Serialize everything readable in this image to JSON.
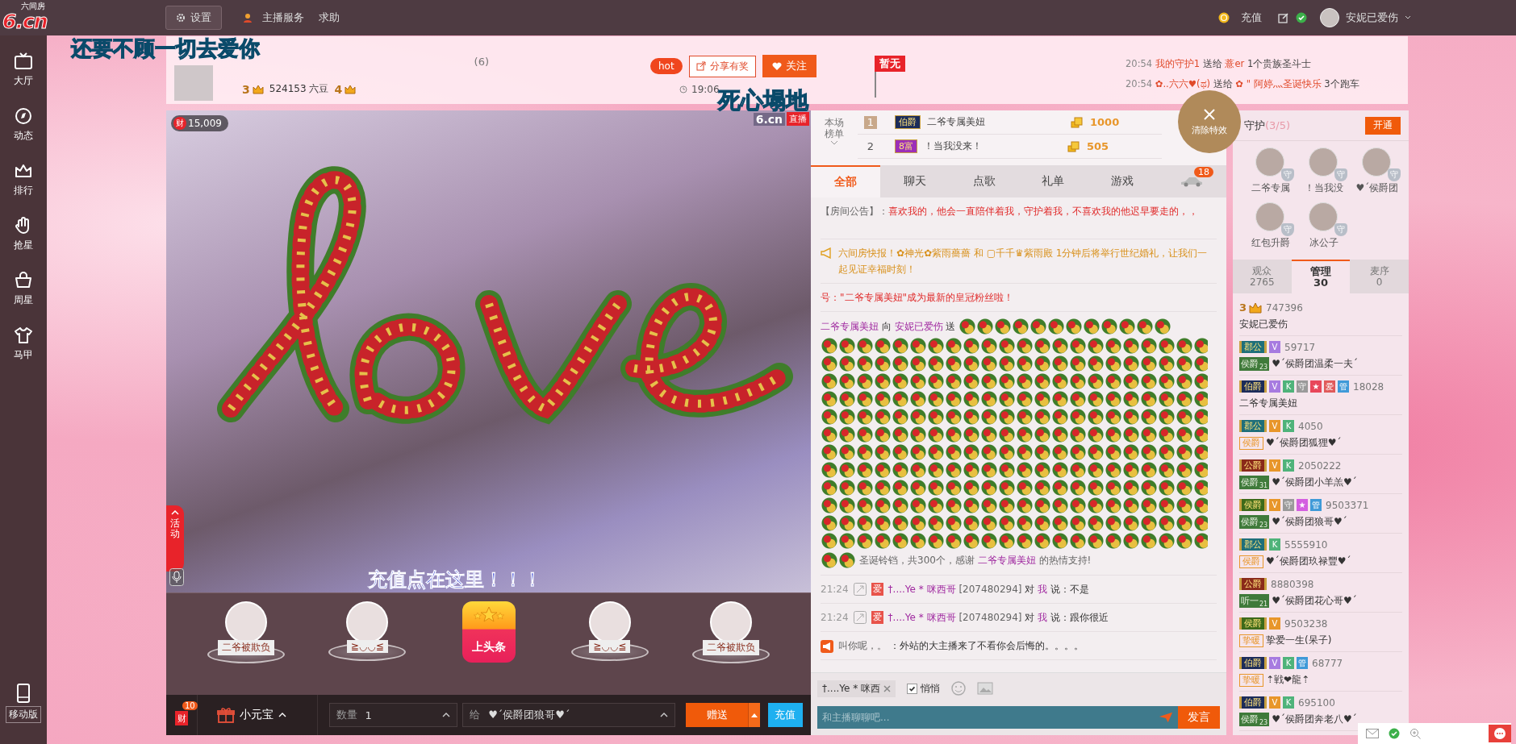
{
  "top_bar": {
    "logo": "6.cn",
    "logo_sub": "六间房",
    "settings": "设置",
    "links": [
      "主播服务",
      "求助"
    ],
    "recharge": "充值",
    "user": "安妮已爱伤"
  },
  "sidebar": {
    "items": [
      {
        "label": "大厅",
        "kind": "tv"
      },
      {
        "label": "动态",
        "kind": "compass"
      },
      {
        "label": "排行",
        "kind": "crown"
      },
      {
        "label": "抢星",
        "kind": "hand"
      },
      {
        "label": "周星",
        "kind": "pot"
      },
      {
        "label": "马甲",
        "kind": "shirt"
      }
    ],
    "mobile": "移动版"
  },
  "header": {
    "name": "(6)",
    "crown_level": "3",
    "beans": "524153 六豆",
    "crown_level_2": "4",
    "hot": "hot",
    "share": "分享有奖",
    "follow": "关注",
    "time": "19:06",
    "flag": "暂无",
    "notices": [
      {
        "time": "20:54",
        "from": "我的守护1",
        "verb": "送给",
        "to": "薏er",
        "gift": "1个贵族圣斗士"
      },
      {
        "time": "20:54",
        "from": "✿..六六♥(ಥ)",
        "verb": "送给",
        "to": "✿ \" 阿婷灬圣诞快乐",
        "gift": "3个跑车"
      }
    ]
  },
  "lyrics": [
    "还要不顾一切去爱你",
    "死心塌地"
  ],
  "video": {
    "wealth_icon": "财",
    "wealth": "15,009",
    "site": "6.cn",
    "live": "直播",
    "activity": "活动",
    "promo": "充值点在这里！！！"
  },
  "gift_strip": [
    {
      "kind": "avatar",
      "label": "二爷被欺负"
    },
    {
      "kind": "avatar",
      "label": "≧◡◡≦"
    },
    {
      "kind": "headline",
      "label": "上头条"
    },
    {
      "kind": "avatar",
      "label": "≧◡◡≦"
    },
    {
      "kind": "avatar",
      "label": "二爷被欺负"
    }
  ],
  "bottom_bar": {
    "wealth": "财",
    "wealth_count": "10",
    "gift": "小元宝",
    "qty_label": "数量",
    "qty": "1",
    "to_label": "给",
    "to": "♥ˊ侯爵团狼哥♥ˊ",
    "send": "赠送",
    "recharge": "充值"
  },
  "ranking": {
    "title": "本场榜单",
    "rows": [
      {
        "rank": "1",
        "badge": "伯爵",
        "color": "#1c2c5a",
        "name": "二爷专属美妞",
        "coins": "1000"
      },
      {
        "rank": "2",
        "badge": "8富",
        "color": "#9c2fb8",
        "name": "！当我没来！",
        "coins": "505"
      }
    ]
  },
  "clear_effects": "清除特效",
  "chat_tabs": [
    {
      "label": "全部",
      "selected": true
    },
    {
      "label": "聊天",
      "selected": false
    },
    {
      "label": "点歌",
      "selected": false
    },
    {
      "label": "礼单",
      "selected": false
    },
    {
      "label": "游戏",
      "selected": false
    }
  ],
  "car_count": "18",
  "messages": [
    {
      "kind": "notice",
      "label": "【房间公告】：",
      "text": "喜欢我的，他会一直陪伴着我，守护着我，不喜欢我的他迟早要走的，，"
    },
    {
      "kind": "broadcast",
      "text": "六间房快报！✿神光✿紫雨薔薔 和 ▢千千♛紫雨殿 1分钟后将举行世纪婚礼，让我们一起见证幸福时刻！"
    },
    {
      "kind": "system",
      "text": "号：\"二爷专属美妞\"成为最新的皇冠粉丝啦！"
    },
    {
      "kind": "gift",
      "from": "二爷专属美妞",
      "verb": "向",
      "to": "安妮已爱伤",
      "send": "送",
      "caption_pre": "圣诞铃铛，共300个，感谢",
      "caption_name": "二爷专属美妞",
      "caption_post": "的热情支持!"
    },
    {
      "kind": "chat",
      "time": "21:24",
      "badge": "爱",
      "from": "†....Ye * 咪西哥",
      "id": "[207480294]",
      "verb": "对",
      "to": "我",
      "said": "说：不是"
    },
    {
      "kind": "chat",
      "time": "21:24",
      "badge": "爱",
      "from": "†....Ye * 咪西哥",
      "id": "[207480294]",
      "verb": "对",
      "to": "我",
      "said": "说：跟你很近"
    },
    {
      "kind": "shout",
      "from": "叫你呢，。",
      "text": "：外站的大主播来了不看你会后悔的。。。。"
    }
  ],
  "chat_input": {
    "target": "†....Ye * 咪西",
    "whisper": "悄悄",
    "whisper_checked": true,
    "placeholder": "和主播聊聊吧...",
    "send": "发言"
  },
  "guards": {
    "title": "守护",
    "count": "(3/5)",
    "open": "开通",
    "items": [
      {
        "name": "二爷专属",
        "badge": "守"
      },
      {
        "name": "！当我没",
        "badge": "守"
      },
      {
        "name": "♥ˊ侯爵团",
        "badge": "守"
      },
      {
        "name": "红包升爵",
        "badge": "守"
      },
      {
        "name": "冰公子",
        "badge": "守"
      }
    ]
  },
  "audience_tabs": [
    {
      "label": "观众",
      "count": "2765",
      "selected": false
    },
    {
      "label": "管理",
      "count": "30",
      "selected": true
    },
    {
      "label": "麦序",
      "count": "0",
      "selected": false
    }
  ],
  "users": [
    {
      "crown": "3",
      "id": "747396",
      "name": "安妮已爱伤"
    },
    {
      "rank": {
        "text": "郡公",
        "color": "#1f6f7a"
      },
      "badges": [
        {
          "text": "V",
          "color": "#a77be0"
        }
      ],
      "id": "59717",
      "tag": {
        "kind": "medal",
        "text": "侯爵",
        "num": "23"
      },
      "name": "♥ˊ侯爵团温柔一夫ˊ"
    },
    {
      "rank": {
        "text": "伯爵",
        "color": "#1c2c5a"
      },
      "badges": [
        {
          "text": "V",
          "color": "#a77be0"
        },
        {
          "text": "K",
          "color": "#4fb37a"
        },
        {
          "text": "守",
          "color": "#9a9a9a"
        },
        {
          "text": "★",
          "color": "#e8475a"
        },
        {
          "text": "爱",
          "color": "#e05a5a"
        },
        {
          "text": "管",
          "color": "#3f9ad8"
        }
      ],
      "id": "18028",
      "name": "二爷专属美妞"
    },
    {
      "rank": {
        "text": "郡公",
        "color": "#1f6f7a"
      },
      "badges": [
        {
          "text": "V",
          "color": "#e8962a"
        },
        {
          "text": "K",
          "color": "#4fb37a"
        }
      ],
      "id": "4050",
      "tag": {
        "kind": "frame",
        "text": "侯爵"
      },
      "name": "♥ˊ侯爵团狐狸♥ˊ"
    },
    {
      "rank": {
        "text": "公爵",
        "color": "#8a2a1a"
      },
      "badges": [
        {
          "text": "V",
          "color": "#e8962a"
        },
        {
          "text": "K",
          "color": "#4fb37a"
        }
      ],
      "id": "2050222",
      "tag": {
        "kind": "medal",
        "text": "侯爵",
        "num": "31"
      },
      "name": "♥ˊ侯爵团小羊羔♥ˊ"
    },
    {
      "rank": {
        "text": "侯爵",
        "color": "#3d6a1a"
      },
      "badges": [
        {
          "text": "V",
          "color": "#e8962a"
        },
        {
          "text": "守",
          "color": "#9a9a9a"
        },
        {
          "text": "★",
          "color": "#d45ee0"
        },
        {
          "text": "管",
          "color": "#3f9ad8"
        }
      ],
      "id": "9503371",
      "tag": {
        "kind": "medal",
        "text": "侯爵",
        "num": "23"
      },
      "name": "♥ˊ侯爵团狼哥♥ˊ"
    },
    {
      "rank": {
        "text": "郡公",
        "color": "#1f6f7a"
      },
      "badges": [
        {
          "text": "K",
          "color": "#4fb37a"
        }
      ],
      "id": "5555910",
      "tag": {
        "kind": "frame",
        "text": "侯爵"
      },
      "name": "♥ˊ侯爵团玖禄豐♥ˊ"
    },
    {
      "rank": {
        "text": "公爵",
        "color": "#8a2a1a"
      },
      "id": "8880398",
      "tag": {
        "kind": "medal",
        "text": "听一",
        "num": "21"
      },
      "name": "♥ˊ侯爵团花心哥♥ˊ"
    },
    {
      "rank": {
        "text": "侯爵",
        "color": "#3d6a1a"
      },
      "badges": [
        {
          "text": "V",
          "color": "#e8962a"
        }
      ],
      "id": "9503238",
      "tag": {
        "kind": "frame",
        "text": "挚暖"
      },
      "name": "挚爱一生(呆子)"
    },
    {
      "rank": {
        "text": "伯爵",
        "color": "#1c2c5a"
      },
      "badges": [
        {
          "text": "V",
          "color": "#a77be0"
        },
        {
          "text": "K",
          "color": "#4fb37a"
        },
        {
          "text": "管",
          "color": "#3f9ad8"
        }
      ],
      "id": "68777",
      "tag": {
        "kind": "frame",
        "text": "挚暖"
      },
      "name": "⇡戦❤龍⇡"
    },
    {
      "rank": {
        "text": "伯爵",
        "color": "#1c2c5a"
      },
      "badges": [
        {
          "text": "V",
          "color": "#e8962a"
        },
        {
          "text": "K",
          "color": "#4fb37a"
        }
      ],
      "id": "695100",
      "tag": {
        "kind": "medal",
        "text": "侯爵",
        "num": "23"
      },
      "name": "♥ˊ侯爵团奔老八♥ˊ"
    }
  ]
}
